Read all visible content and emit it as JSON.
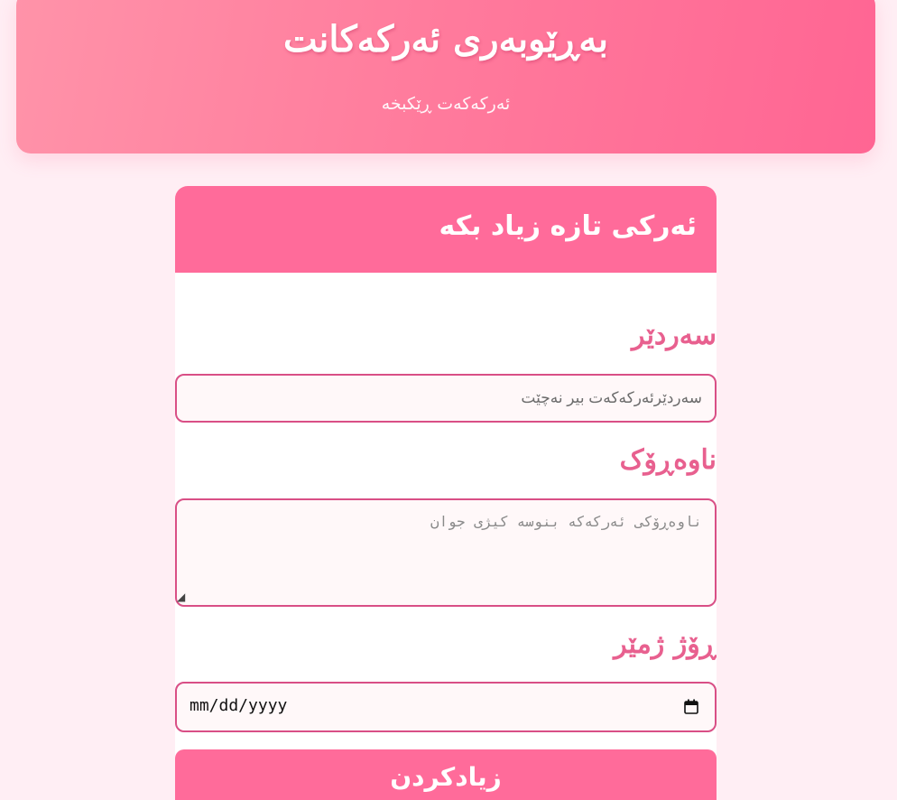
{
  "header": {
    "title": "بەڕێوبەری ئەرکەکانت",
    "subtitle": "ئەرکەکەت ڕێکبخە"
  },
  "form": {
    "heading": "ئەرکی تازە زیاد بکە",
    "title_label": "سەردێر",
    "title_placeholder": "سەردێرئەرکەکەت بیر نەچێت",
    "content_label": "ناوەڕۆک",
    "content_placeholder": "ناوەڕۆکی ئەرکەکە بنوسە کیژی جوان",
    "date_label": "ڕۆژ ژمێر",
    "date_value": "mm/dd/yyyy",
    "submit_label": "زیادکردن"
  },
  "colors": {
    "accent": "#ff6b9a",
    "label": "#e8608f",
    "border": "#d94f86",
    "background": "#ffeef4"
  }
}
